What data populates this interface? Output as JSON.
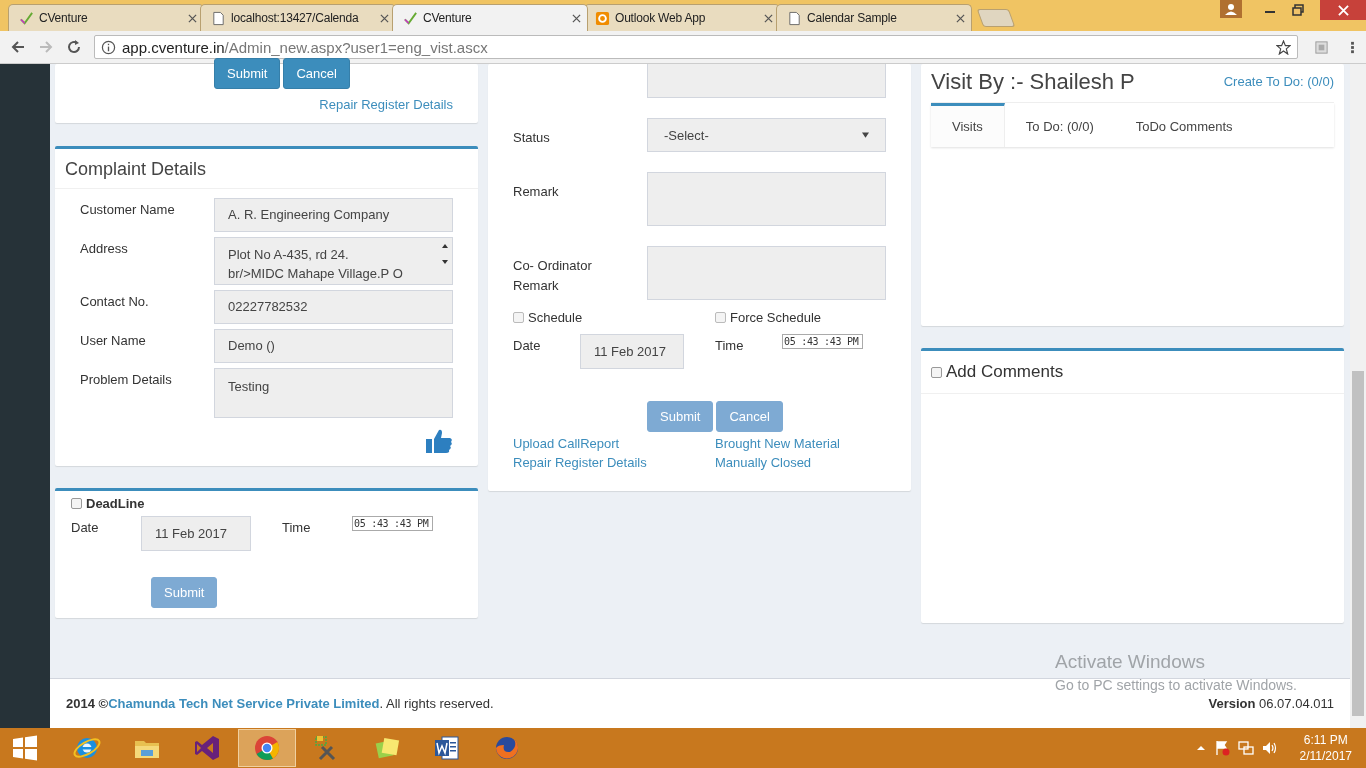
{
  "browser": {
    "tabs": [
      {
        "title": "CVenture",
        "kind": "check",
        "selected": false
      },
      {
        "title": "localhost:13427/Calenda",
        "kind": "page",
        "selected": false
      },
      {
        "title": "CVenture",
        "kind": "check",
        "selected": true
      },
      {
        "title": "Outlook Web App",
        "kind": "outlook",
        "selected": false
      },
      {
        "title": "Calendar Sample",
        "kind": "page",
        "selected": false
      }
    ],
    "url": {
      "host": "app.cventure.in",
      "path": "/Admin_new.aspx?user1=eng_vist.ascx"
    }
  },
  "repair_card": {
    "buttons": [
      {
        "label": "Submit",
        "disabled": false
      },
      {
        "label": "Cancel",
        "disabled": false
      }
    ],
    "link": "Repair Register Details"
  },
  "complaint": {
    "title": "Complaint Details",
    "fields": [
      {
        "label": "Customer Name",
        "value": "A. R. Engineering Company",
        "kind": "input"
      },
      {
        "label": "Address",
        "value": "Plot No A-435, rd 24.\nbr/>MIDC Mahape Village.P O",
        "kind": "scroll"
      },
      {
        "label": "Contact No.",
        "value": "02227782532",
        "kind": "input"
      },
      {
        "label": "User Name",
        "value": "Demo ()",
        "kind": "input"
      },
      {
        "label": "Problem Details",
        "value": "Testing",
        "kind": "textarea"
      }
    ]
  },
  "deadline": {
    "label": "DeadLine",
    "checked": false,
    "date_label": "Date",
    "date": "11 Feb 2017",
    "time_label": "Time",
    "time": "05 :43 :43  PM",
    "button": {
      "label": "Submit",
      "disabled": true
    }
  },
  "visit_form": {
    "status": {
      "label": "Status",
      "value": "-Select-"
    },
    "remarks": [
      {
        "label": "Remark"
      },
      {
        "label": "Co- Ordinator Remark"
      }
    ],
    "checks": [
      {
        "label": "Schedule",
        "checked": false
      },
      {
        "label": "Force Schedule",
        "checked": false
      }
    ],
    "date_label": "Date",
    "date": "11 Feb 2017",
    "time_label": "Time",
    "time": "05 :43 :43  PM",
    "buttons": [
      {
        "label": "Submit",
        "disabled": true
      },
      {
        "label": "Cancel",
        "disabled": true
      }
    ],
    "links": [
      "Upload CallReport",
      "Brought New Material",
      "Repair Register Details",
      "Manually Closed"
    ]
  },
  "visits": {
    "title": "Visit By :- Shailesh P",
    "create_link": "Create To Do: (0/0)",
    "tabs": [
      {
        "label": "Visits",
        "selected": true
      },
      {
        "label": "To Do: (0/0)",
        "selected": false
      },
      {
        "label": "ToDo Comments",
        "selected": false
      }
    ]
  },
  "comments": {
    "label": "Add Comments",
    "checked": false
  },
  "footer": {
    "year": "2014 ©",
    "company": "Chamunda Tech Net Service Private Limited",
    "suffix": ". All rights reserved.",
    "version": "**Version** 06.07.04.011"
  },
  "activation": {
    "title": "Activate Windows",
    "hint": "Go to PC settings to activate Windows."
  },
  "taskbar": {
    "apps": [
      {
        "kind": "ie",
        "selected": false
      },
      {
        "kind": "folder",
        "selected": false
      },
      {
        "kind": "vs",
        "selected": false
      },
      {
        "kind": "chrome",
        "selected": true
      },
      {
        "kind": "tools",
        "selected": false
      },
      {
        "kind": "notes",
        "selected": false
      },
      {
        "kind": "word",
        "selected": false
      },
      {
        "kind": "firefox",
        "selected": false
      }
    ],
    "time": "6:11 PM",
    "date": "2/11/2017"
  }
}
